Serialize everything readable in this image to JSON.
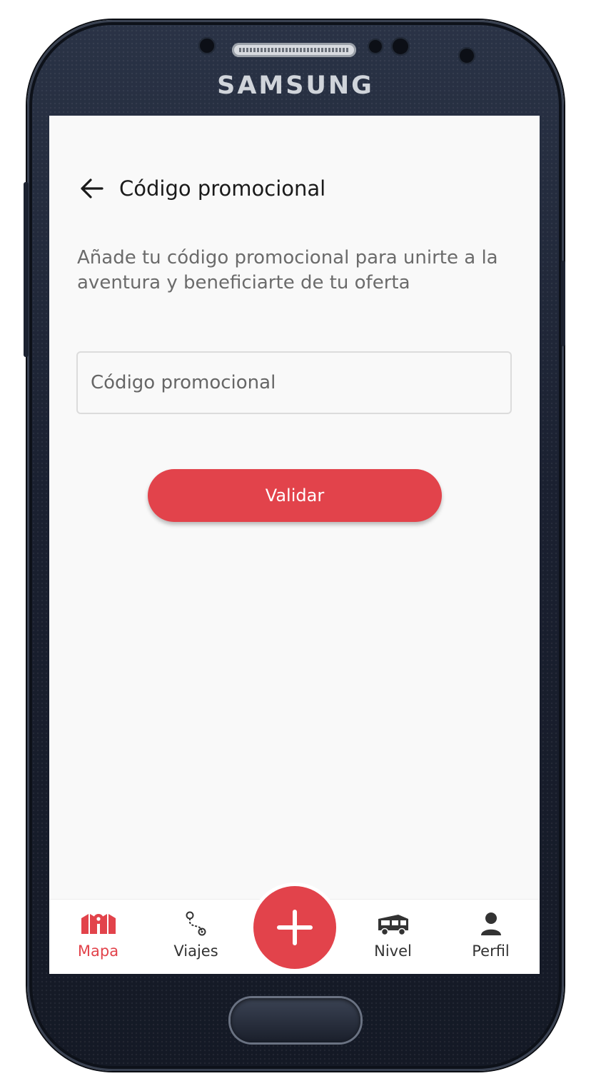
{
  "device": {
    "brand": "SAMSUNG"
  },
  "header": {
    "title": "Código promocional"
  },
  "description": "Añade tu código promocional para unirte a la aventura y beneficiarte de tu oferta",
  "promo_input": {
    "placeholder": "Código promocional",
    "value": ""
  },
  "validate_button": {
    "label": "Validar"
  },
  "bottom_nav": {
    "items": [
      {
        "label": "Mapa",
        "icon": "map-icon",
        "active": true
      },
      {
        "label": "Viajes",
        "icon": "route-icon",
        "active": false
      },
      {
        "label": "Nivel",
        "icon": "camper-van-icon",
        "active": false
      },
      {
        "label": "Perfil",
        "icon": "user-icon",
        "active": false
      }
    ],
    "fab_icon": "plus-icon"
  },
  "colors": {
    "accent": "#e2434b",
    "background": "#f9f9f9",
    "text": "#1a1a1a",
    "muted": "#6b6b6b"
  }
}
